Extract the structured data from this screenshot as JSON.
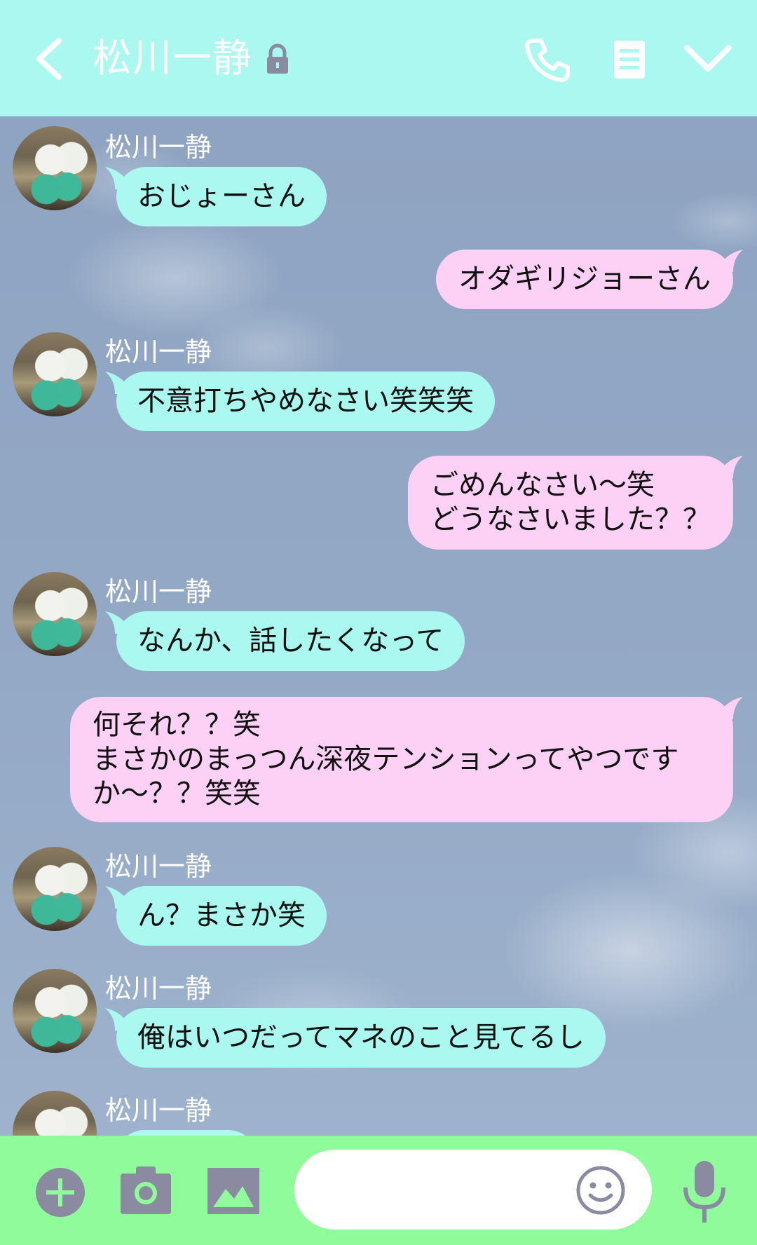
{
  "header": {
    "title": "松川一静",
    "icons": [
      "back-icon",
      "lock-icon",
      "phone-icon",
      "menu-icon",
      "chevron-down-icon"
    ]
  },
  "messages": [
    {
      "side": "in",
      "sender": "松川一静",
      "text": "おじょーさん"
    },
    {
      "side": "out",
      "text": "オダギリジョーさん"
    },
    {
      "side": "in",
      "sender": "松川一静",
      "text": "不意打ちやめなさい笑笑笑"
    },
    {
      "side": "out",
      "text": "ごめんなさい〜笑\nどうなさいました？？"
    },
    {
      "side": "in",
      "sender": "松川一静",
      "text": "なんか、話したくなって"
    },
    {
      "side": "out",
      "text": "何それ？？笑\nまさかのまっつん深夜テンションってやつです\nか〜？？笑笑"
    },
    {
      "side": "in",
      "sender": "松川一静",
      "text": "ん？まさか笑"
    },
    {
      "side": "in",
      "sender": "松川一静",
      "text": "俺はいつだってマネのこと見てるし"
    },
    {
      "side": "in",
      "sender": "松川一静",
      "text": ""
    }
  ],
  "footer": {
    "input_placeholder": "",
    "icons": [
      "plus-icon",
      "camera-icon",
      "image-icon",
      "emoji-icon",
      "mic-icon"
    ]
  },
  "colors": {
    "header_bg": "#aaf8ef",
    "incoming_bubble": "#aaf8ef",
    "outgoing_bubble": "#fdd0f6",
    "footer_bg": "#8ffb9a",
    "icon_gray": "#8a8aa0"
  }
}
